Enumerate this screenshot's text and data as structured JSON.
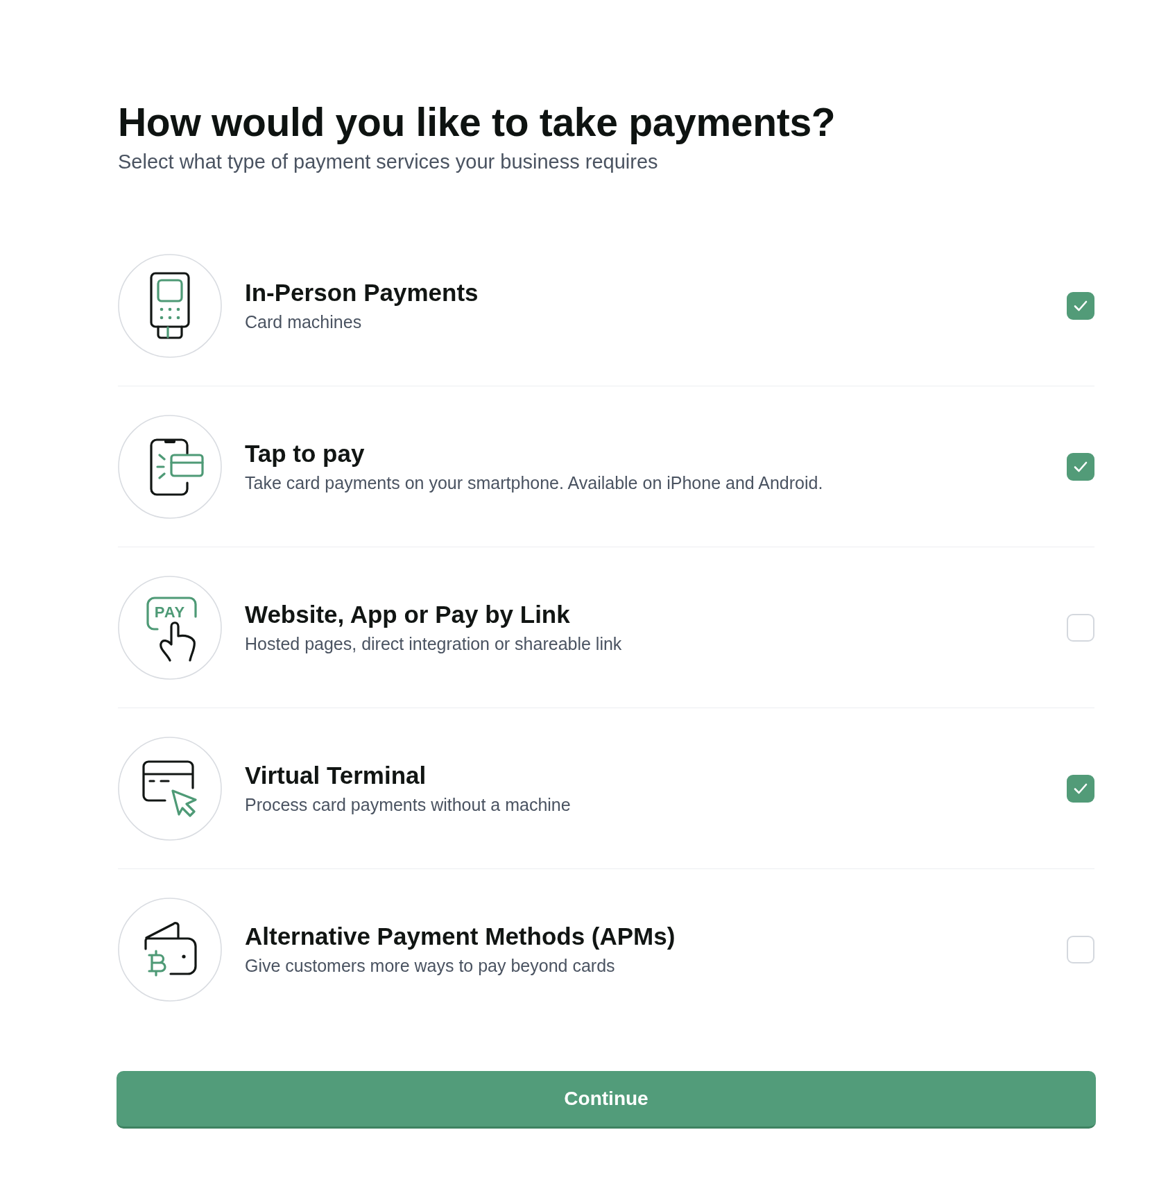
{
  "heading": "How would you like to take payments?",
  "subheading": "Select what type of payment services your business requires",
  "options": [
    {
      "kind": "card-terminal",
      "title": "In-Person Payments",
      "description": "Card machines",
      "checked": true
    },
    {
      "kind": "tap-phone",
      "title": "Tap to pay",
      "description": "Take card payments on your smartphone. Available on iPhone and Android.",
      "checked": true
    },
    {
      "kind": "pay-link",
      "icon_label": "PAY",
      "title": "Website, App or Pay by Link",
      "description": "Hosted pages, direct integration or shareable link",
      "checked": false
    },
    {
      "kind": "virtual-terminal",
      "title": "Virtual Terminal",
      "description": "Process card payments without a machine",
      "checked": true
    },
    {
      "kind": "crypto-wallet",
      "title": "Alternative Payment Methods (APMs)",
      "description": "Give customers more ways to pay beyond cards",
      "checked": false
    }
  ],
  "continue_button": {
    "label": "Continue"
  }
}
